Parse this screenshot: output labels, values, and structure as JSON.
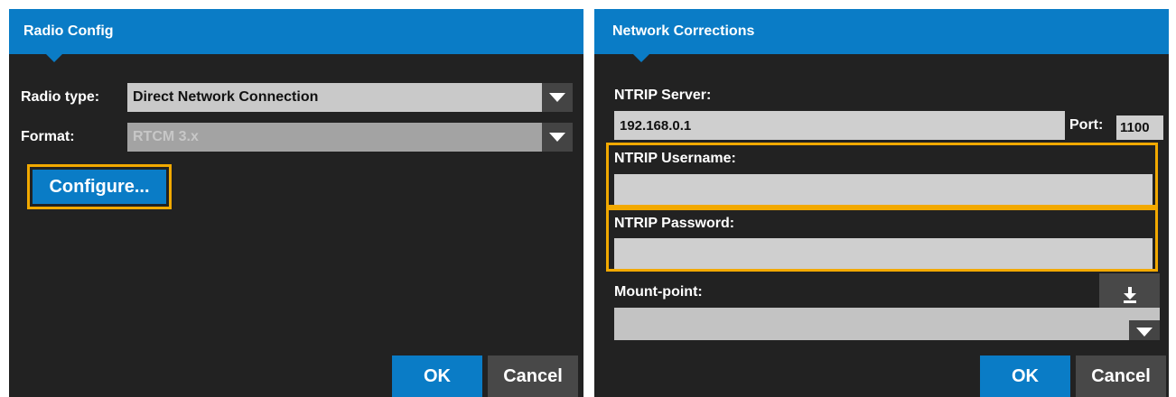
{
  "radio_config": {
    "title": "Radio Config",
    "radio_type_label": "Radio type:",
    "radio_type_value": "Direct Network Connection",
    "format_label": "Format:",
    "format_value": "RTCM 3.x",
    "configure_label": "Configure...",
    "ok_label": "OK",
    "cancel_label": "Cancel"
  },
  "network_corrections": {
    "title": "Network Corrections",
    "ntrip_server_label": "NTRIP Server:",
    "ntrip_server_value": "192.168.0.1",
    "port_label": "Port:",
    "port_value": "1100",
    "username_label": "NTRIP Username:",
    "username_value": "",
    "password_label": "NTRIP Password:",
    "password_value": "",
    "mount_point_label": "Mount-point:",
    "mount_point_value": "",
    "ok_label": "OK",
    "cancel_label": "Cancel"
  },
  "icons": {
    "dropdown": "chevron-down-icon",
    "download": "download-icon"
  },
  "colors": {
    "accent": "#0a7cc6",
    "highlight": "#f2a900",
    "panel_bg": "#222222"
  }
}
